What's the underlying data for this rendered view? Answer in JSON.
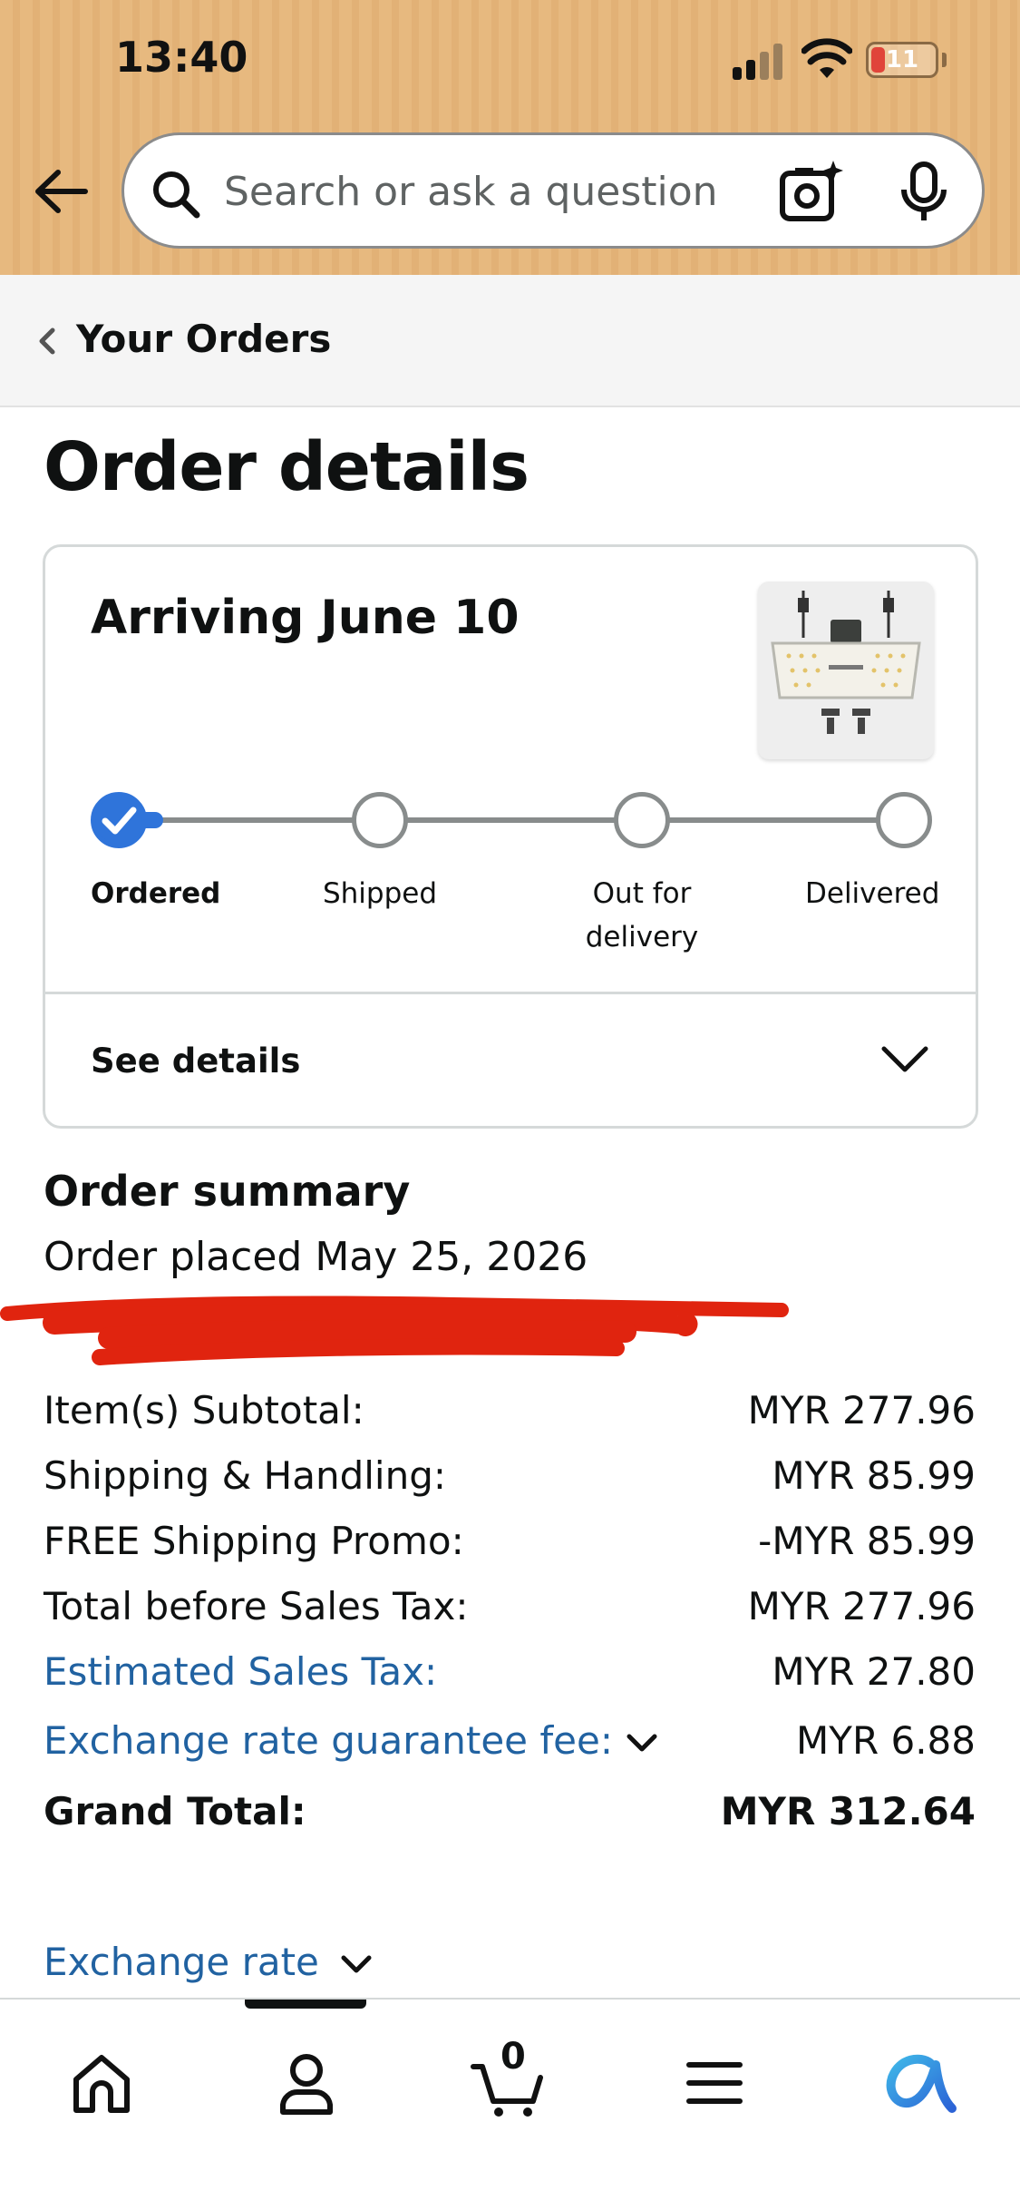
{
  "status_bar": {
    "time": "13:40",
    "battery": "11"
  },
  "search": {
    "placeholder": "Search or ask a question"
  },
  "breadcrumb": {
    "label": "Your Orders"
  },
  "page_title": "Order details",
  "shipment": {
    "arriving": "Arriving June 10",
    "progress_step": 1,
    "steps": [
      {
        "label": "Ordered",
        "done": true
      },
      {
        "label": "Shipped",
        "done": false
      },
      {
        "label": "Out for delivery",
        "done": false
      },
      {
        "label": "Delivered",
        "done": false
      }
    ],
    "see_details": "See details"
  },
  "summary": {
    "title": "Order summary",
    "order_placed": "Order placed May 25, 2026",
    "rows": [
      {
        "label": "Item(s) Subtotal:",
        "value": "MYR 277.96"
      },
      {
        "label": "Shipping & Handling:",
        "value": "MYR 85.99"
      },
      {
        "label": "FREE Shipping Promo:",
        "value": "-MYR 85.99"
      },
      {
        "label": "Total before Sales Tax:",
        "value": "MYR 277.96"
      },
      {
        "label": "Estimated Sales Tax:",
        "value": "MYR 27.80"
      },
      {
        "label": "Exchange rate guarantee fee:",
        "value": "MYR 6.88"
      },
      {
        "label": "Grand Total:",
        "value": "MYR 312.64"
      }
    ],
    "exchange_rate_link": "Exchange rate"
  },
  "tab_bar": {
    "cart_count": "0",
    "active_tab": "account"
  },
  "colors": {
    "header_bg": "#e7b97f",
    "link": "#2162a1",
    "progress_done": "#2f74da",
    "redaction": "#e0240f"
  }
}
